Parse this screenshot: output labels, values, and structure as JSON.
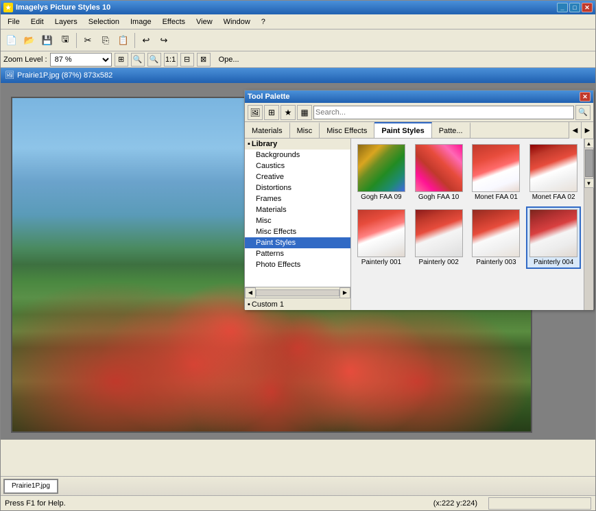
{
  "app": {
    "title": "Imagelys Picture Styles 10",
    "title_icon": "★"
  },
  "menu": {
    "items": [
      "File",
      "Edit",
      "Layers",
      "Selection",
      "Image",
      "Effects",
      "View",
      "Window",
      "?"
    ]
  },
  "toolbar": {
    "buttons": [
      "new",
      "open",
      "save",
      "saveAs",
      "cut",
      "copy",
      "paste",
      "undo",
      "redo"
    ]
  },
  "zoom": {
    "label": "Zoom Level :",
    "value": "87 %",
    "open_label": "Ope..."
  },
  "image_title": {
    "text": "Prairie1P.jpg (87%) 873x582"
  },
  "tool_palette": {
    "title": "Tool Palette",
    "tabs": [
      "Materials",
      "Misc",
      "Misc Effects",
      "Paint Styles",
      "Patte..."
    ],
    "active_tab": "Paint Styles"
  },
  "library": {
    "header": "Library",
    "items": [
      {
        "label": "Backgrounds",
        "indent": 1
      },
      {
        "label": "Caustics",
        "indent": 1
      },
      {
        "label": "Creative",
        "indent": 1
      },
      {
        "label": "Distortions",
        "indent": 1
      },
      {
        "label": "Frames",
        "indent": 1
      },
      {
        "label": "Materials",
        "indent": 1
      },
      {
        "label": "Misc",
        "indent": 1
      },
      {
        "label": "Misc Effects",
        "indent": 1
      },
      {
        "label": "Paint Styles",
        "indent": 1,
        "selected": true
      },
      {
        "label": "Patterns",
        "indent": 1
      },
      {
        "label": "Photo Effects",
        "indent": 1
      }
    ],
    "custom": {
      "label": "Custom 1",
      "indent": 0
    }
  },
  "styles": {
    "row1": [
      {
        "id": "gogh09",
        "label": "Gogh FAA 09",
        "thumb_class": "thumb-gogh09"
      },
      {
        "id": "gogh10",
        "label": "Gogh FAA 10",
        "thumb_class": "thumb-gogh10"
      },
      {
        "id": "monet01",
        "label": "Monet FAA 01",
        "thumb_class": "thumb-monet01"
      },
      {
        "id": "monet02",
        "label": "Monet FAA 02",
        "thumb_class": "thumb-monet02"
      }
    ],
    "row2": [
      {
        "id": "painterly001",
        "label": "Painterly 001",
        "thumb_class": "thumb-painterly001"
      },
      {
        "id": "painterly002",
        "label": "Painterly 002",
        "thumb_class": "thumb-painterly002"
      },
      {
        "id": "painterly003",
        "label": "Painterly 003",
        "thumb_class": "thumb-painterly003"
      },
      {
        "id": "painterly004",
        "label": "Painterly 004",
        "thumb_class": "thumb-painterly004",
        "selected": true
      }
    ]
  },
  "statusbar": {
    "help_text": "Press F1 for Help.",
    "filename": "Prairie1P.jpg",
    "coordinates": "(x:222 y:224)"
  },
  "colors": {
    "title_bar_start": "#4a90d9",
    "title_bar_end": "#2060b0",
    "selected_tab_border": "#316ac5",
    "selected_item_bg": "#316ac5"
  }
}
